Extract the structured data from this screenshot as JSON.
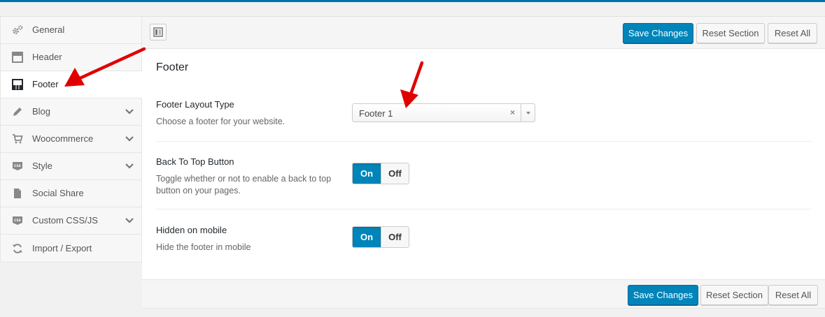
{
  "sidebar": {
    "items": [
      {
        "label": "General",
        "icon": "gears-icon",
        "has_chevron": false
      },
      {
        "label": "Header",
        "icon": "header-layout-icon",
        "has_chevron": false
      },
      {
        "label": "Footer",
        "icon": "footer-layout-icon",
        "has_chevron": false,
        "active": true
      },
      {
        "label": "Blog",
        "icon": "pencil-icon",
        "has_chevron": true
      },
      {
        "label": "Woocommerce",
        "icon": "cart-icon",
        "has_chevron": true
      },
      {
        "label": "Style",
        "icon": "css-icon",
        "has_chevron": true
      },
      {
        "label": "Social Share",
        "icon": "file-icon",
        "has_chevron": false
      },
      {
        "label": "Custom CSS/JS",
        "icon": "css-icon",
        "has_chevron": true
      },
      {
        "label": "Import / Export",
        "icon": "refresh-icon",
        "has_chevron": false
      }
    ]
  },
  "toolbar": {
    "save_label": "Save Changes",
    "reset_section_label": "Reset Section",
    "reset_all_label": "Reset All"
  },
  "section": {
    "title": "Footer",
    "fields": [
      {
        "name": "Footer Layout Type",
        "desc": "Choose a footer for your website.",
        "type": "select",
        "value": "Footer 1",
        "clear": "×"
      },
      {
        "name": "Back To Top Button",
        "desc": "Toggle whether or not to enable a back to top button on your pages.",
        "type": "toggle",
        "on": "On",
        "off": "Off",
        "selected": "On"
      },
      {
        "name": "Hidden on mobile",
        "desc": "Hide the footer in mobile",
        "type": "toggle",
        "on": "On",
        "off": "Off",
        "selected": "On"
      }
    ]
  },
  "colors": {
    "accent": "#0085ba",
    "annotation_arrow": "#e00000"
  }
}
